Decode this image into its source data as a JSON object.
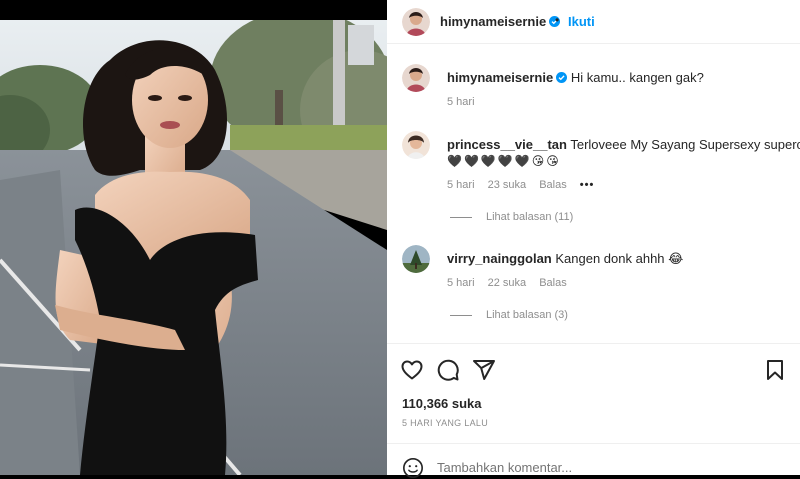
{
  "post": {
    "author": "himynameisernie",
    "follow_separator": "•",
    "follow_label": "Ikuti"
  },
  "caption": {
    "username": "himynameisernie",
    "text": "Hi kamu.. kangen gak?",
    "time": "5 hari"
  },
  "comments": [
    {
      "username": "princess__vie__tan",
      "text": "Terloveee My Sayang Supersexy supercantik",
      "emoji_line": [
        "🖤",
        "🖤",
        "🖤",
        "🖤",
        "🖤",
        "😘",
        "😘"
      ],
      "time": "5 hari",
      "likes": "23 suka",
      "reply": "Balas",
      "more": "•••",
      "view_replies": "Lihat balasan (11)"
    },
    {
      "username": "virry_nainggolan",
      "text": "Kangen donk ahhh 😂",
      "time": "5 hari",
      "likes": "22 suka",
      "reply": "Balas",
      "view_replies": "Lihat balasan (3)"
    }
  ],
  "stats": {
    "likes": "110,366 suka",
    "posted": "5 HARI YANG LALU"
  },
  "add_comment": {
    "placeholder": "Tambahkan komentar..."
  },
  "icons": {
    "like": "heart-icon",
    "comment": "comment-icon",
    "share": "share-icon",
    "save": "bookmark-icon",
    "emoji": "emoji-icon",
    "verified": "verified-badge-icon"
  },
  "colors": {
    "accent": "#0095f6",
    "verified": "#0095f6",
    "muted": "#8e8e8e",
    "text": "#262626",
    "border": "#efefef"
  }
}
